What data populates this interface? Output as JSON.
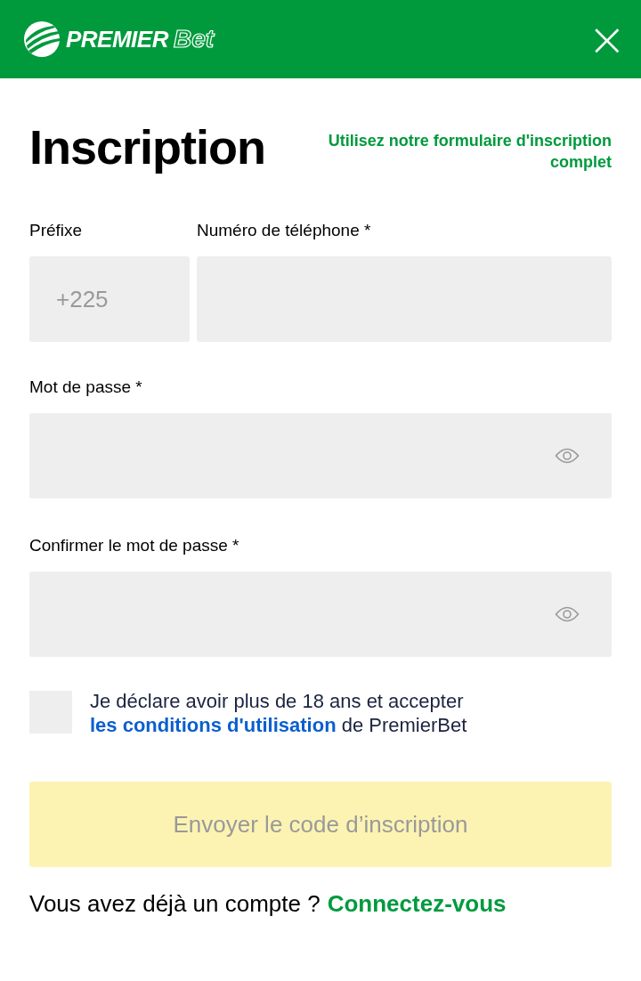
{
  "header": {
    "logo": {
      "word_1": "PREMIER",
      "word_2": "Bet"
    },
    "close": "×"
  },
  "title": "Inscription",
  "full_form_link": "Utilisez notre formulaire d'inscription complet",
  "phone_row": [
    {
      "label": "Préfixe",
      "value": "+225",
      "kind": "prefix"
    },
    {
      "label": "Numéro de téléphone *",
      "kind": "phone"
    }
  ],
  "password_fields": [
    {
      "label": "Mot de passe *",
      "kind": "password"
    },
    {
      "label": "Confirmer le mot de passe *",
      "kind": "password"
    }
  ],
  "consent": {
    "checked": false,
    "text_before": "Je déclare avoir plus de 18 ans et accepter ",
    "link": "les conditions d'utilisation",
    "text_after": " de PremierBet"
  },
  "submit": {
    "label": "Envoyer le code d’inscription",
    "disabled": true
  },
  "login_prompt": {
    "text": "Vous avez déjà un compte ?",
    "link": "Connectez-vous"
  }
}
